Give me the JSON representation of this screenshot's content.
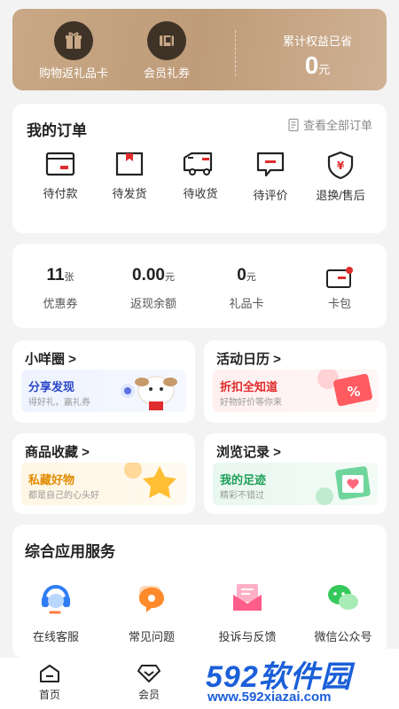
{
  "benefits": {
    "gift_card_label": "购物返礼品卡",
    "coupon_label": "会员礼券",
    "saved_label": "累计权益已省",
    "saved_value": "0",
    "saved_unit": "元"
  },
  "orders": {
    "title": "我的订单",
    "view_all": "查看全部订单",
    "items": [
      {
        "label": "待付款",
        "icon": "wallet-icon"
      },
      {
        "label": "待发货",
        "icon": "package-icon"
      },
      {
        "label": "待收货",
        "icon": "truck-icon"
      },
      {
        "label": "待评价",
        "icon": "comment-icon"
      },
      {
        "label": "退换/售后",
        "icon": "shield-yen-icon"
      }
    ]
  },
  "wallet": {
    "items": [
      {
        "value": "11",
        "unit": "张",
        "label": "优惠券"
      },
      {
        "value": "0.00",
        "unit": "元",
        "label": "返现余额"
      },
      {
        "value": "0",
        "unit": "元",
        "label": "礼品卡"
      },
      {
        "value": "",
        "unit": "",
        "label": "卡包"
      }
    ]
  },
  "tiles": [
    {
      "title": "小咩圈 >",
      "banner_title": "分享发现",
      "banner_sub": "得好礼，赢礼券"
    },
    {
      "title": "活动日历 >",
      "banner_title": "折扣全知道",
      "banner_sub": "好物好价等你来"
    },
    {
      "title": "商品收藏 >",
      "banner_title": "私藏好物",
      "banner_sub": "都是自己的心头好"
    },
    {
      "title": "浏览记录 >",
      "banner_title": "我的足迹",
      "banner_sub": "精彩不错过"
    }
  ],
  "services": {
    "title": "综合应用服务",
    "items": [
      {
        "label": "在线客服"
      },
      {
        "label": "常见问题"
      },
      {
        "label": "投诉与反馈"
      },
      {
        "label": "微信公众号"
      }
    ]
  },
  "tabbar": {
    "items": [
      {
        "label": "首页"
      },
      {
        "label": "会员"
      }
    ]
  },
  "watermark": {
    "brand": "592软件园",
    "url": "www.592xiazai.com"
  },
  "colors": {
    "accent": "#e02c2c",
    "gold": "#c4a27f"
  }
}
